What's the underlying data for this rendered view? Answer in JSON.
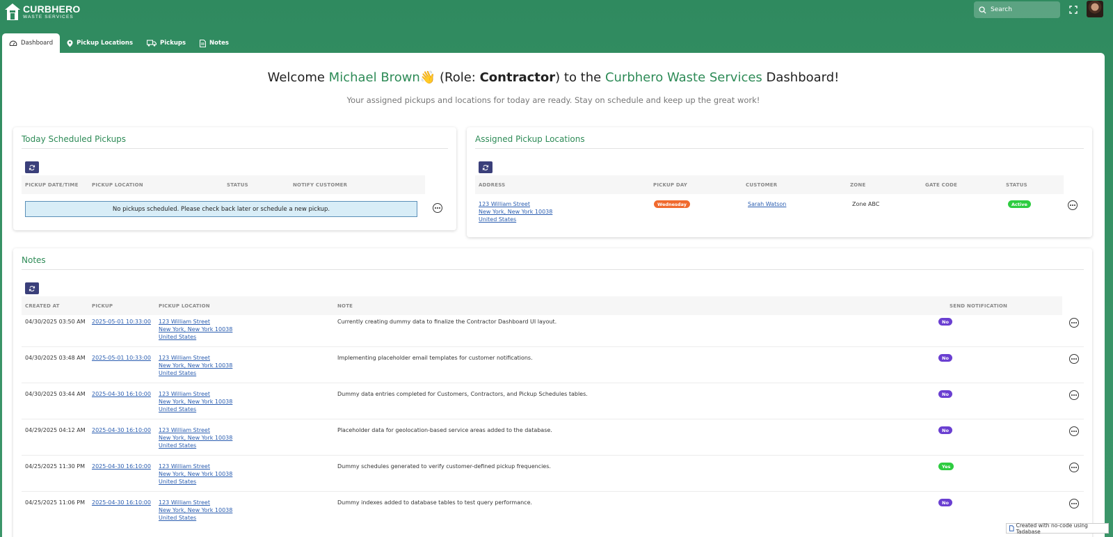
{
  "header": {
    "logo_name": "CURBHERO",
    "logo_sub": "WASTE SERVICES",
    "search_placeholder": "Search"
  },
  "tabs": [
    {
      "label": "Dashboard",
      "icon": "gauge-icon",
      "active": true
    },
    {
      "label": "Pickup Locations",
      "icon": "map-pin-icon"
    },
    {
      "label": "Pickups",
      "icon": "truck-icon"
    },
    {
      "label": "Notes",
      "icon": "document-icon"
    }
  ],
  "welcome": {
    "prefix": "Welcome ",
    "name": "Michael Brown",
    "emoji": "👋",
    "role_prefix": " (Role: ",
    "role": "Contractor",
    "role_suffix": ") to the ",
    "company": "Curbhero Waste Services",
    "suffix": " Dashboard!",
    "subtitle": "Your assigned pickups and locations for today are ready. Stay on schedule and keep up the great work!"
  },
  "today_pickups": {
    "title": "Today Scheduled Pickups",
    "columns": [
      "PICKUP DATE/TIME",
      "PICKUP LOCATION",
      "STATUS",
      "NOTIFY CUSTOMER"
    ],
    "empty_message": "No pickups scheduled. Please check back later or schedule a new pickup."
  },
  "assigned_locations": {
    "title": "Assigned Pickup Locations",
    "columns": [
      "ADDRESS",
      "PICKUP DAY",
      "CUSTOMER",
      "ZONE",
      "GATE CODE",
      "STATUS"
    ],
    "rows": [
      {
        "address_line1": "123 William Street",
        "address_line2": "New York, New York 10038",
        "address_line3": "United States",
        "pickup_day": "Wednesday",
        "customer": "Sarah Watson",
        "zone": "Zone ABC",
        "gate_code": "",
        "status": "Active"
      }
    ]
  },
  "notes": {
    "title": "Notes",
    "columns": [
      "CREATED AT",
      "PICKUP",
      "PICKUP LOCATION",
      "NOTE",
      "SEND NOTIFICATION"
    ],
    "rows": [
      {
        "created_at": "04/30/2025 03:50 AM",
        "pickup": "2025-05-01 10:33:00",
        "loc1": "123 William Street",
        "loc2": "New York, New York 10038",
        "loc3": "United States",
        "note": "Currently creating dummy data to finalize the Contractor Dashboard UI layout.",
        "send": "No"
      },
      {
        "created_at": "04/30/2025 03:48 AM",
        "pickup": "2025-05-01 10:33:00",
        "loc1": "123 William Street",
        "loc2": "New York, New York 10038",
        "loc3": "United States",
        "note": "Implementing placeholder email templates for customer notifications.",
        "send": "No"
      },
      {
        "created_at": "04/30/2025 03:44 AM",
        "pickup": "2025-04-30 16:10:00",
        "loc1": "123 William Street",
        "loc2": "New York, New York 10038",
        "loc3": "United States",
        "note": "Dummy data entries completed for Customers, Contractors, and Pickup Schedules tables.",
        "send": "No"
      },
      {
        "created_at": "04/29/2025 04:12 AM",
        "pickup": "2025-04-30 16:10:00",
        "loc1": "123 William Street",
        "loc2": "New York, New York 10038",
        "loc3": "United States",
        "note": "Placeholder data for geolocation-based service areas added to the database.",
        "send": "No"
      },
      {
        "created_at": "04/25/2025 11:30 PM",
        "pickup": "2025-04-30 16:10:00",
        "loc1": "123 William Street",
        "loc2": "New York, New York 10038",
        "loc3": "United States",
        "note": "Dummy schedules generated to verify customer-defined pickup frequencies.",
        "send": "Yes"
      },
      {
        "created_at": "04/25/2025 11:06 PM",
        "pickup": "2025-04-30 16:10:00",
        "loc1": "123 William Street",
        "loc2": "New York, New York 10038",
        "loc3": "United States",
        "note": "Dummy indexes added to database tables to test query performance.",
        "send": "No"
      }
    ]
  },
  "footer_badge": "Created with no-code using Tadabase",
  "colors": {
    "brand_green": "#2e8b57",
    "refresh_button": "#3a3f7a",
    "pill_no": "#6a3fd1",
    "pill_yes": "#2ecc40",
    "pill_day": "#f06a2e"
  }
}
